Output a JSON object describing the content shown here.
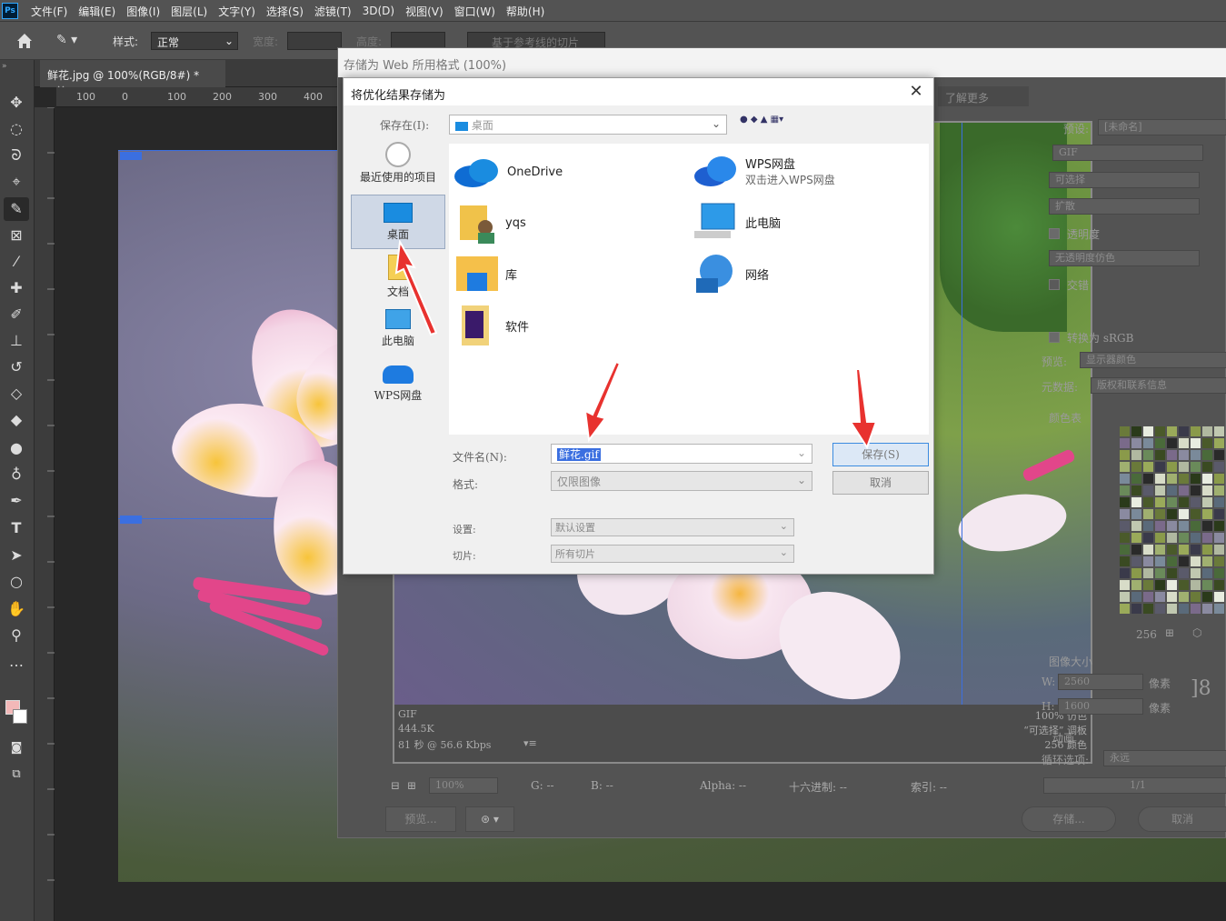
{
  "menubar": {
    "logo": "Ps",
    "items": [
      "文件(F)",
      "编辑(E)",
      "图像(I)",
      "图层(L)",
      "文字(Y)",
      "选择(S)",
      "滤镜(T)",
      "3D(D)",
      "视图(V)",
      "窗口(W)",
      "帮助(H)"
    ]
  },
  "options": {
    "style_label": "样式:",
    "style_value": "正常",
    "width_label": "宽度:",
    "height_label": "高度:",
    "slice_button": "基于参考线的切片"
  },
  "document": {
    "tab_title": "鲜花.jpg @ 100%(RGB/8#) *",
    "close": "×"
  },
  "ruler": {
    "h_ticks": [
      "100",
      "0",
      "100",
      "200",
      "300",
      "400"
    ]
  },
  "sfw": {
    "title": "存储为 Web 所用格式 (100%)",
    "learn_more": "了解更多",
    "preview_info": {
      "format": "GIF",
      "size": "444.5K",
      "time": "81 秒 @ 56.6 Kbps",
      "dither": "100% 仿色",
      "palette": "“可选择” 调板",
      "colors": "256 颜色"
    },
    "right": {
      "preset_label": "预设:",
      "preset_value": "[未命名]",
      "format_value": "GIF",
      "reduction_value": "可选择",
      "dither_value": "扩散",
      "transparency_label": "透明度",
      "matte_value": "无透明度仿色",
      "interlaced_label": "交错",
      "convert_srgb_label": "转换为 sRGB",
      "preview_label": "预览:",
      "preview_value": "显示器颜色",
      "metadata_label": "元数据:",
      "metadata_value": "版权和联系信息",
      "color_table_label": "颜色表",
      "color_count": "256",
      "image_size_label": "图像大小",
      "w_label": "W:",
      "w_value": "2560",
      "h_label": "H:",
      "h_value": "1600",
      "px_unit": "像素",
      "animation_label": "动画",
      "loop_label": "循环选项:",
      "loop_value": "永远",
      "frame": "1/1"
    },
    "bottom": {
      "zoom": "100%",
      "g": "G: --",
      "b": "B: --",
      "alpha": "Alpha: --",
      "hex": "十六进制: --",
      "index": "索引: --",
      "preview_btn": "预览...",
      "save_btn": "存储...",
      "cancel_btn": "取消"
    }
  },
  "save_dialog": {
    "title": "将优化结果存储为",
    "close": "✕",
    "save_in_label": "保存在(I):",
    "save_in_value": "桌面",
    "places": [
      "最近使用的项目",
      "桌面",
      "文档",
      "此电脑",
      "WPS网盘"
    ],
    "files": [
      {
        "name": "OneDrive",
        "sub": ""
      },
      {
        "name": "WPS网盘",
        "sub": "双击进入WPS网盘"
      },
      {
        "name": "yqs",
        "sub": ""
      },
      {
        "name": "此电脑",
        "sub": ""
      },
      {
        "name": "库",
        "sub": ""
      },
      {
        "name": "网络",
        "sub": ""
      },
      {
        "name": "软件",
        "sub": ""
      }
    ],
    "filename_label": "文件名(N):",
    "filename_value": "鲜花.gif",
    "format_label": "格式:",
    "format_value": "仅限图像",
    "settings_label": "设置:",
    "settings_value": "默认设置",
    "slices_label": "切片:",
    "slices_value": "所有切片",
    "save_button": "保存(S)",
    "cancel_button": "取消"
  },
  "colors": {
    "accent_red": "#e8322f",
    "selection_blue": "#3b6fe0"
  }
}
